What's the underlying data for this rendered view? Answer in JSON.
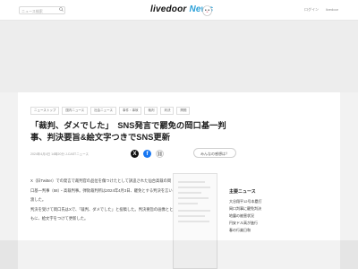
{
  "header": {
    "search_placeholder": "ニュース検索",
    "logo_main": "livedoor",
    "logo_accent": "News",
    "login": "ログイン",
    "livedoor": "livedoor"
  },
  "article": {
    "tags": [
      "ニューストップ",
      "国内ニュース",
      "社会ニュース",
      "事件・事故",
      "裁判",
      "判決",
      "問題"
    ],
    "title": "「裁判、ダメでした」　SNS発言で罷免の岡口基一判事、判決要旨&絵文字つきでSNS更新",
    "date": "2024年4月4日 14時20分",
    "source": "J-CASTニュース",
    "poll": "みんなの感想は？",
    "body": [
      "X（旧Twitter）での発言で裁判官の品位を傷つけたとして訴追された仙台高裁の岡口基一判事（58）・高裁判事。弾劾裁判所は2024年4月3日、罷免とする判決を言い渡した。",
      "判決を受けて岡口氏はXで、「裁判、ダメでした」と投稿した。判決要旨の画像とともに、絵文字をつけて更新した。"
    ]
  },
  "ranking": {
    "title": "主要ニュース",
    "items": [
      "大谷翔平12号本塁打",
      "岡口判事に罷免判決",
      "地震の被害状況",
      "円安ドル高が進行",
      "春の行楽日和"
    ]
  },
  "colors": {
    "accent": "#2ba0d8"
  }
}
